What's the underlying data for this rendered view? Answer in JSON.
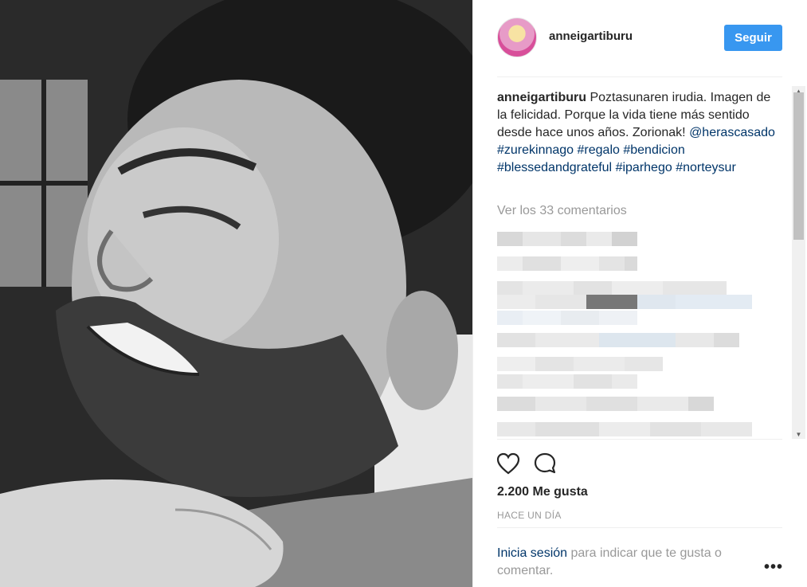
{
  "photo": {
    "icon": "photo-of-smiling-man-and-child"
  },
  "header": {
    "username": "anneigartiburu",
    "follow_label": "Seguir",
    "accent": "#3897f0"
  },
  "caption": {
    "user": "anneigartiburu",
    "text": "Poztasunaren irudia. Imagen de la felicidad. Porque la vida tiene más sentido desde hace unos años. Zorionak!",
    "mention": "@herascasado",
    "hashtags": [
      "#zurekinnago",
      "#regalo",
      "#bendicion",
      "#blessedandgrateful",
      "#iparhego",
      "#norteysur"
    ]
  },
  "comments": {
    "view_all": "Ver los 33 comentarios"
  },
  "actions": {
    "like_icon": "heart-icon",
    "comment_icon": "comment-icon",
    "likes": "2.200 Me gusta",
    "time": "HACE UN DÍA"
  },
  "footer": {
    "login_link": "Inicia sesión",
    "login_text": " para indicar que te gusta o comentar.",
    "more_label": "•••"
  },
  "colors": {
    "text": "#262626",
    "muted": "#999999",
    "link": "#003569",
    "divider": "#efefef"
  }
}
